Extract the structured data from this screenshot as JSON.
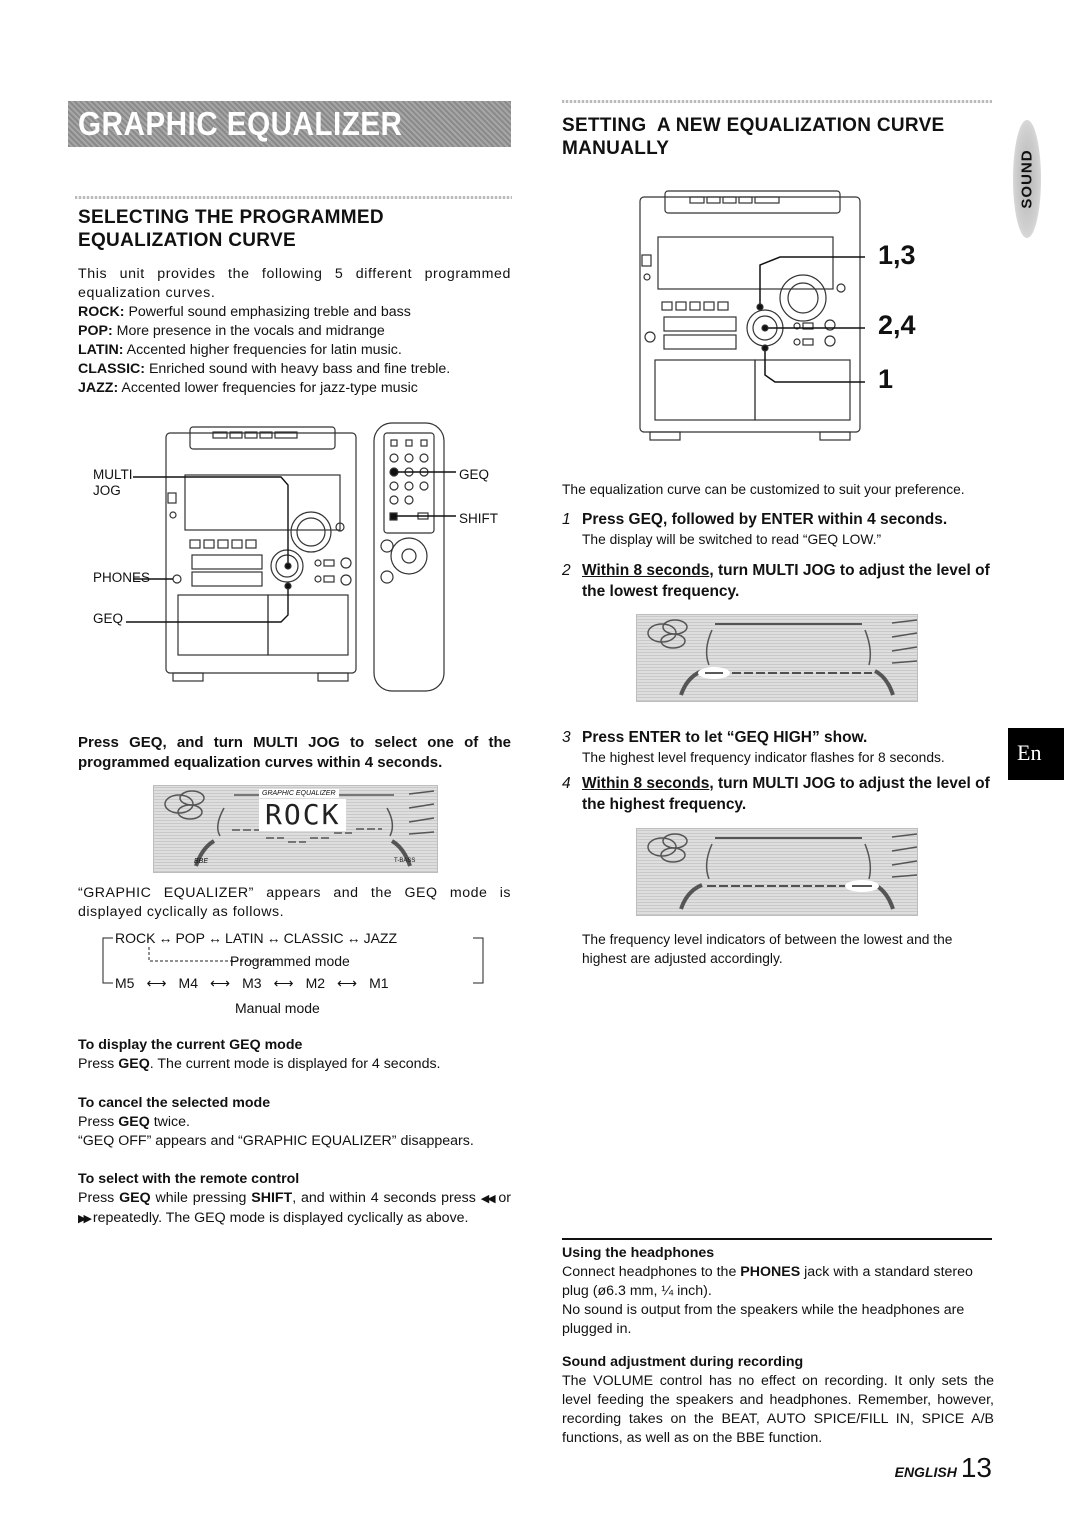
{
  "banner": {
    "title": "GRAPHIC EQUALIZER"
  },
  "side_tabs": {
    "section": "SOUND",
    "language": "En"
  },
  "left": {
    "heading": [
      "SELECTING THE PROGRAMMED",
      "EQUALIZATION CURVE"
    ],
    "intro": "This unit provides the following 5 different programmed equalization curves.",
    "curves": [
      {
        "name": "ROCK:",
        "desc": "Powerful sound emphasizing treble and bass"
      },
      {
        "name": "POP:",
        "desc": "More presence in the vocals and midrange"
      },
      {
        "name": "LATIN:",
        "desc": "Accented higher frequencies for latin music."
      },
      {
        "name": "CLASSIC:",
        "desc": "Enriched sound with heavy bass and fine treble."
      },
      {
        "name": "JAZZ:",
        "desc": "Accented lower frequencies for jazz-type music"
      }
    ],
    "figure_labels": {
      "multi_jog": [
        "MULTI",
        "JOG"
      ],
      "phones": "PHONES",
      "geq_unit": "GEQ",
      "geq_remote": "GEQ",
      "shift": "SHIFT"
    },
    "instruction": "Press GEQ, and turn MULTI JOG to select one of the programmed equalization curves within 4 seconds.",
    "lcd": {
      "caption": "GRAPHIC EQUALIZER",
      "text": "ROCK",
      "bbe": "BBE",
      "tbass": "T-BASS"
    },
    "after_lcd": "“GRAPHIC EQUALIZER” appears and the GEQ mode is displayed cyclically as follows.",
    "cycle": {
      "programmed": [
        "ROCK",
        "POP",
        "LATIN",
        "CLASSIC",
        "JAZZ"
      ],
      "programmed_label": "Programmed mode",
      "manual": [
        "M5",
        "M4",
        "M3",
        "M2",
        "M1"
      ],
      "manual_label": "Manual mode"
    },
    "sections": [
      {
        "title": "To display the current GEQ mode",
        "pre": "Press ",
        "bold1": "GEQ",
        "post": ". The current mode is displayed for 4 seconds."
      },
      {
        "title": "To cancel the selected mode",
        "pre": "Press ",
        "bold1": "GEQ",
        "post": " twice.",
        "line2": "“GEQ OFF” appears and “GRAPHIC EQUALIZER” disappears."
      },
      {
        "title": "To select with the remote control",
        "pre": "Press ",
        "bold1": "GEQ",
        "mid": " while pressing ",
        "bold2": "SHIFT",
        "post": ", and within 4 seconds press",
        "line2_pre": "◀◀",
        "line2_or": "or",
        "line2_btn": "▶▶",
        "line2": " repeatedly. The GEQ mode is displayed cyclically as above."
      }
    ]
  },
  "right": {
    "heading": [
      "SETTING  A NEW EQUALIZATION CURVE",
      "MANUALLY"
    ],
    "callouts": [
      "1,3",
      "2,4",
      "1"
    ],
    "intro": "The equalization curve can be customized to suit your preference.",
    "steps": [
      {
        "num": "1",
        "ul": "",
        "text": "Press GEQ, followed by ENTER within 4 seconds.",
        "note": "The display will be switched to read “GEQ LOW.”"
      },
      {
        "num": "2",
        "ul": "Within 8 seconds",
        "text": ", turn MULTI JOG to adjust the level of the lowest frequency.",
        "note": ""
      },
      {
        "num": "3",
        "ul": "",
        "text": "Press ENTER to let “GEQ HIGH” show.",
        "note": "The highest level frequency indicator flashes for 8 seconds."
      },
      {
        "num": "4",
        "ul": "Within 8 seconds",
        "text": ", turn MULTI JOG to adjust the level of the highest frequency.",
        "note": ""
      }
    ],
    "after_steps": "The frequency level indicators of between the lowest and the highest are adjusted accordingly.",
    "headphones": {
      "title": "Using the headphones",
      "pre": "Connect headphones to the ",
      "bold": "PHONES",
      "post": " jack with a standard stereo plug (ø6.3 mm, ¼ inch).",
      "line2": "No sound is output from the speakers while the headphones are plugged in."
    },
    "recording": {
      "title": "Sound adjustment during recording",
      "text": "The VOLUME control has no effect on recording. It only sets the level feeding the speakers and headphones. Remember, however, recording takes on the BEAT, AUTO SPICE/FILL IN, SPICE A/B functions, as well as on the BBE function."
    }
  },
  "footer": {
    "language": "ENGLISH",
    "page": "13"
  }
}
